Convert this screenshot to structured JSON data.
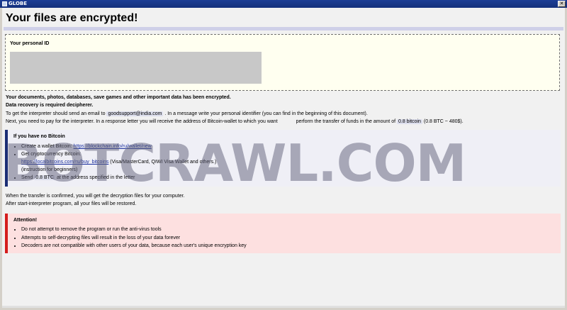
{
  "window": {
    "title": "GLOBE"
  },
  "heading": "Your files are encrypted!",
  "personal_id": {
    "label": "Your personal ID"
  },
  "intro": {
    "line1": "Your documents, photos, databases, save games and other important data has been encrypted.",
    "line2": "Data recovery is required decipherer.",
    "line3_pre": "To get the interpreter should send an email to",
    "email": "goodsupport@india.com",
    "line3_post": ". In a message write your personal identifier (you can find in the beginning of this document).",
    "line4_pre": "Next, you need to pay for the interpreter. In a response letter you will receive the address of Bitcoin-wallet to which you want",
    "line4_mid": "perform the transfer of funds in the amount of",
    "amount": "0.8 bitcoin",
    "line4_post": "(0.8 BTC ~ 480$)."
  },
  "no_bitcoin": {
    "title": "If you have no Bitcoin",
    "create_text": "Create a wallet Bitcoin:",
    "create_link": "https://blockchain.info/ru/wallet/new",
    "get_text": "Get cryptocurrency Bitcoin:",
    "buy_link": "https://localbitcoins.com/ru/buy_bitcoins",
    "buy_after": "(Visa/MasterCard, QIWI Visa Wallet and others.)",
    "instructions": "(instruction for beginners)",
    "send_pre": "Send",
    "send_amount": "0.8 BTC",
    "send_post": "at the address specified in the letter"
  },
  "after": {
    "line1": "When the transfer is confirmed, you will get the decryption files for your computer.",
    "line2": "After start-interpreter program, all your files will be restored."
  },
  "attention": {
    "title": "Attention!",
    "items": [
      "Do not attempt to remove the program or run the anti-virus tools",
      "Attempts to self-decrypting files will result in the loss of your data forever",
      "Decoders are not compatible with other users of your data, because each user's unique encryption key"
    ]
  },
  "watermark": "BOTCRAWL.COM",
  "colors": {
    "titlebar": "#1d3e95",
    "blue_accent": "#1b2d74",
    "red_accent": "#d41c1c",
    "id_box_bg": "#fffff0"
  }
}
